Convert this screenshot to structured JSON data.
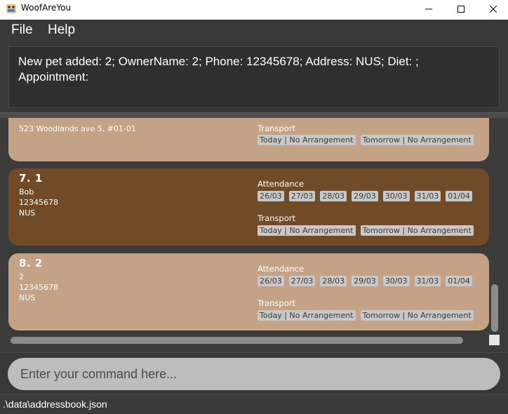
{
  "window": {
    "title": "WoofAreYou"
  },
  "menu": {
    "file": "File",
    "help": "Help"
  },
  "result": {
    "text": "New pet added: 2; OwnerName: 2; Phone: 12345678; Address: NUS; Diet: ; Appointment:"
  },
  "cards": {
    "partial": {
      "address": "523 Woodlands ave 5, #01-01",
      "transport_label": "Transport",
      "transport": [
        "Today | No Arrangement",
        "Tomorrow | No Arrangement"
      ]
    },
    "card7": {
      "title": "7.  1",
      "owner": "Bob",
      "phone": "12345678",
      "address": "NUS",
      "attendance_label": "Attendance",
      "attendance": [
        "26/03",
        "27/03",
        "28/03",
        "29/03",
        "30/03",
        "31/03",
        "01/04"
      ],
      "transport_label": "Transport",
      "transport": [
        "Today | No Arrangement",
        "Tomorrow | No Arrangement"
      ]
    },
    "card8": {
      "title": "8.  2",
      "owner": "2",
      "phone": "12345678",
      "address": "NUS",
      "attendance_label": "Attendance",
      "attendance": [
        "26/03",
        "27/03",
        "28/03",
        "29/03",
        "30/03",
        "31/03",
        "01/04"
      ],
      "transport_label": "Transport",
      "transport": [
        "Today | No Arrangement",
        "Tomorrow | No Arrangement"
      ]
    }
  },
  "command": {
    "placeholder": "Enter your command here..."
  },
  "status": {
    "path": ".\\data\\addressbook.json"
  },
  "colors": {
    "card_light": "#c4a285",
    "card_dark": "#714b27",
    "background": "#383838"
  },
  "icons": {
    "app": "dog-icon",
    "minimize": "minimize-icon",
    "maximize": "maximize-icon",
    "close": "close-icon"
  }
}
